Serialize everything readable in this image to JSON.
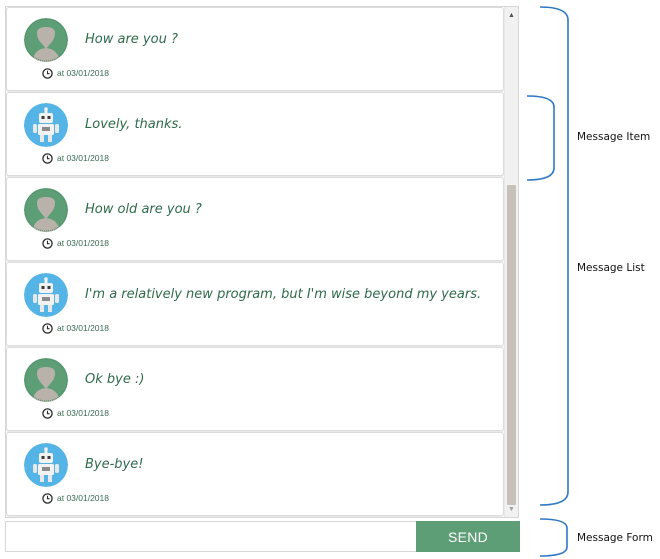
{
  "messages": [
    {
      "sender": "user",
      "text": "How are you ?",
      "time": "at 03/01/2018"
    },
    {
      "sender": "bot",
      "text": "Lovely, thanks.",
      "time": "at 03/01/2018"
    },
    {
      "sender": "user",
      "text": "How old are you ?",
      "time": "at 03/01/2018"
    },
    {
      "sender": "bot",
      "text": "I'm a relatively new program, but I'm wise beyond my years.",
      "time": "at 03/01/2018"
    },
    {
      "sender": "user",
      "text": "Ok bye :)",
      "time": "at 03/01/2018"
    },
    {
      "sender": "bot",
      "text": "Bye-bye!",
      "time": "at 03/01/2018"
    }
  ],
  "form": {
    "input_value": "",
    "input_placeholder": "",
    "send_label": "SEND"
  },
  "annotations": {
    "message_item": "Message Item",
    "message_list": "Message List",
    "message_form": "Message Form"
  },
  "colors": {
    "accent": "#5e9e77",
    "text_green": "#2f6b4a",
    "bracket_blue": "#2f78c4",
    "user_avatar_bg": "#5e9e77",
    "bot_avatar_bg": "#55b4e6"
  },
  "icons": {
    "user_avatar": "user-avatar-icon",
    "bot_avatar": "robot-avatar-icon",
    "timestamp": "clock-icon"
  }
}
